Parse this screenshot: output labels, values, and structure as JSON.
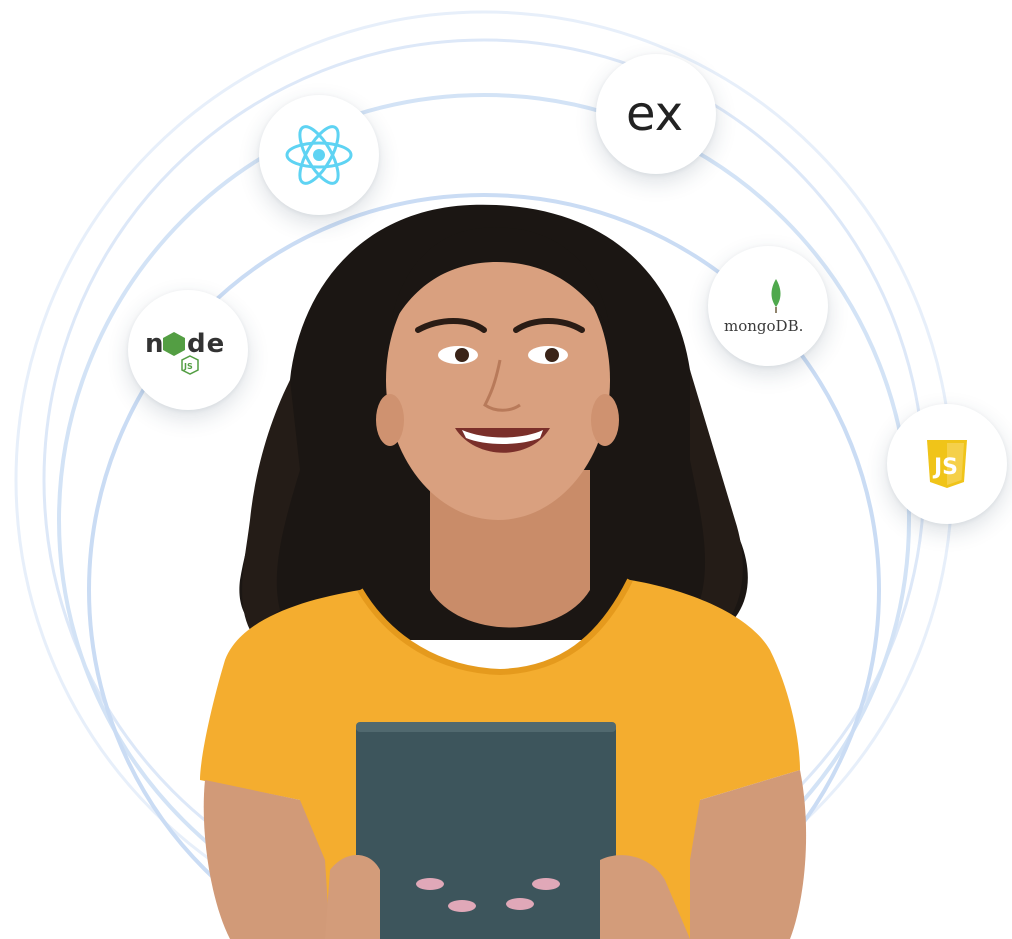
{
  "scene": {
    "description_colors": {
      "background": "#ffffff",
      "orbit": "#d6e4f7",
      "orbit_inner": "#cfe0f6",
      "shirt": "#f4ad2f",
      "tablet": "#3d555c",
      "hair": "#1a1512",
      "skin": "#d9a07f"
    }
  },
  "badges": {
    "node": {
      "icon": "nodejs-logo",
      "label": "node",
      "sub": "JS",
      "color": "#539e43"
    },
    "react": {
      "icon": "react-logo",
      "color": "#5ed3f3"
    },
    "express": {
      "icon": "express-logo",
      "label": "ex",
      "color": "#222222"
    },
    "mongo": {
      "icon": "mongodb-logo",
      "label": "mongoDB.",
      "color": "#4fa94d"
    },
    "js": {
      "icon": "javascript-logo",
      "label": "JS",
      "color": "#f0c419"
    }
  }
}
